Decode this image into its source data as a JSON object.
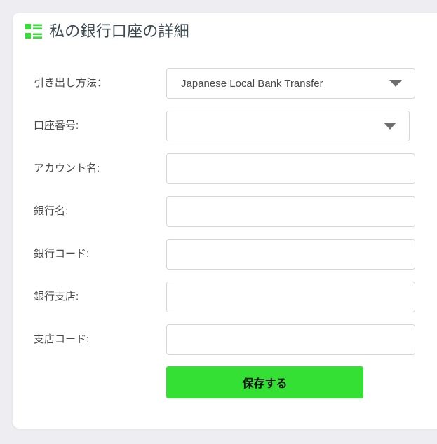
{
  "header": {
    "title": "私の銀行口座の詳細",
    "icon": "list-grid-icon",
    "icon_color": "#33e033",
    "title_color": "#3d4a52"
  },
  "form": {
    "rows": [
      {
        "label": "引き出し方法：",
        "control": "select",
        "value": "Japanese Local Bank Transfer",
        "name": "withdrawal-method"
      },
      {
        "label": "口座番号:",
        "control": "select",
        "value": "",
        "name": "account-number"
      },
      {
        "label": "アカウント名:",
        "control": "text",
        "value": "",
        "placeholder": "",
        "name": "account-name"
      },
      {
        "label": "銀行名:",
        "control": "text",
        "value": "",
        "placeholder": "",
        "name": "bank-name"
      },
      {
        "label": "銀行コード:",
        "control": "text",
        "value": "",
        "placeholder": "",
        "name": "bank-code"
      },
      {
        "label": "銀行支店:",
        "control": "text",
        "value": "",
        "placeholder": "",
        "name": "bank-branch"
      },
      {
        "label": "支店コード:",
        "control": "text",
        "value": "",
        "placeholder": "",
        "name": "branch-code"
      }
    ]
  },
  "actions": {
    "save_label": "保存する",
    "save_color": "#33e033"
  },
  "theme": {
    "page_background": "#eeeef2",
    "card_background": "#ffffff",
    "border_color": "#d6d6d6",
    "label_color": "#4a4a4a"
  }
}
